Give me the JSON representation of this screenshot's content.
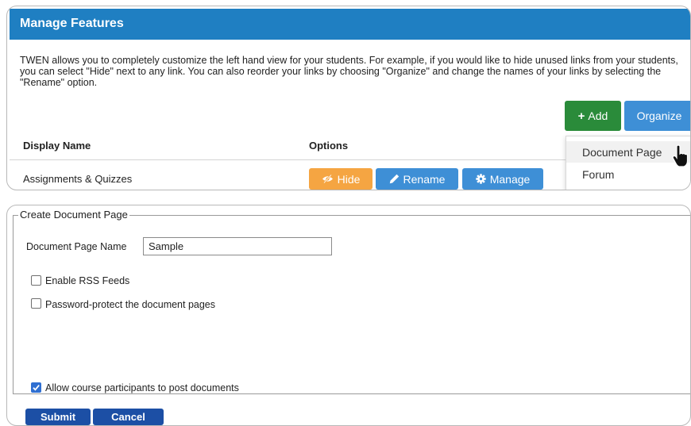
{
  "manage_features": {
    "title": "Manage Features",
    "description": "TWEN allows you to completely customize the left hand view for your students. For example, if you would like to hide unused links from your students, you can select \"Hide\" next to any link. You can also reorder your links by choosing \"Organize\" and change the names of your links by selecting the \"Rename\" option.",
    "add_label": "Add",
    "organize_label": "Organize",
    "columns": {
      "display_name": "Display Name",
      "options": "Options"
    },
    "row": {
      "name": "Assignments & Quizzes",
      "hide": "Hide",
      "rename": "Rename",
      "manage": "Manage"
    },
    "add_menu": [
      "Document Page",
      "Forum"
    ]
  },
  "create_page": {
    "legend": "Create Document Page",
    "name_label": "Document Page Name",
    "name_value": "Sample",
    "rss_label": "Enable RSS Feeds",
    "rss_checked": false,
    "password_label": "Password-protect the document pages",
    "password_checked": false,
    "allow_label": "Allow course participants to post documents",
    "allow_checked": true,
    "submit": "Submit",
    "cancel": "Cancel"
  },
  "colors": {
    "header_blue": "#1f7fc2",
    "add_green": "#2a8b3a",
    "button_blue": "#3e8fd6",
    "hide_orange": "#f5a542",
    "submit_navy": "#1c4fa5"
  },
  "icons": [
    "plus-icon",
    "eye-slash-icon",
    "pencil-icon",
    "gear-icon",
    "hand-pointer-icon",
    "checkmark-icon"
  ]
}
